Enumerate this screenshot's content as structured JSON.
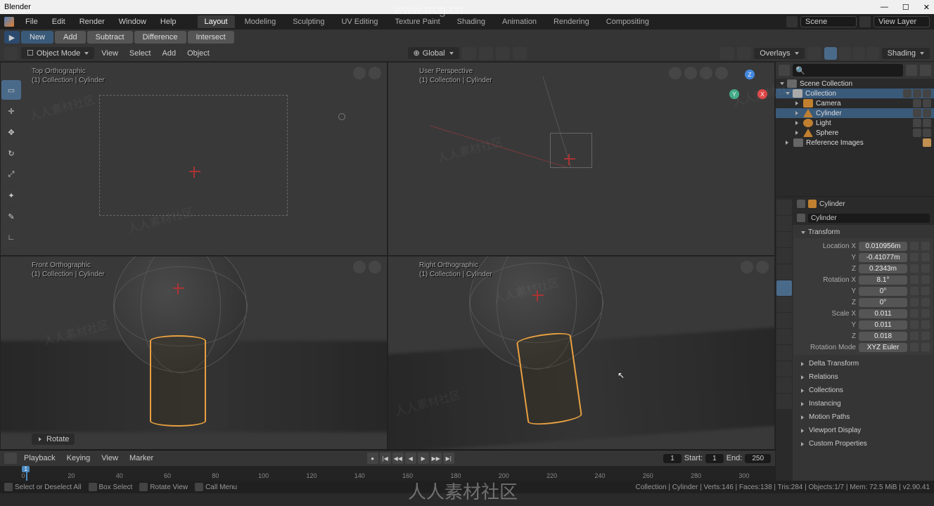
{
  "app": {
    "title": "Blender"
  },
  "menu": {
    "items": [
      "File",
      "Edit",
      "Render",
      "Window",
      "Help"
    ]
  },
  "tabs": {
    "items": [
      "Layout",
      "Modeling",
      "Sculpting",
      "UV Editing",
      "Texture Paint",
      "Shading",
      "Animation",
      "Rendering",
      "Compositing"
    ],
    "active": 0
  },
  "topright": {
    "scene_label": "Scene",
    "viewlayer_label": "View Layer"
  },
  "booltool": {
    "new": "New",
    "add": "Add",
    "subtract": "Subtract",
    "difference": "Difference",
    "intersect": "Intersect"
  },
  "vphead": {
    "mode": "Object Mode",
    "menus": [
      "View",
      "Select",
      "Add",
      "Object"
    ],
    "orientation": "Global",
    "overlays": "Overlays",
    "shading": "Shading"
  },
  "viewports": {
    "tl": {
      "name": "Top Orthographic",
      "sub": "(1) Collection | Cylinder"
    },
    "tr": {
      "name": "User Perspective",
      "sub": "(1) Collection | Cylinder"
    },
    "bl": {
      "name": "Front Orthographic",
      "sub": "(1) Collection | Cylinder"
    },
    "br": {
      "name": "Right Orthographic",
      "sub": "(1) Collection | Cylinder"
    },
    "op": "Rotate"
  },
  "outliner": {
    "root": "Scene Collection",
    "collection": "Collection",
    "items": [
      {
        "name": "Camera",
        "type": "cam"
      },
      {
        "name": "Cylinder",
        "type": "mesh",
        "active": true
      },
      {
        "name": "Light",
        "type": "light"
      },
      {
        "name": "Sphere",
        "type": "mesh"
      }
    ],
    "ref": "Reference Images"
  },
  "props": {
    "context": "Cylinder",
    "context2": "Cylinder",
    "panels": {
      "transform": {
        "title": "Transform",
        "rows": [
          {
            "label": "Location X",
            "value": "0.010956m"
          },
          {
            "label": "Y",
            "value": "-0.41077m"
          },
          {
            "label": "Z",
            "value": "0.2343m"
          },
          {
            "label": "Rotation X",
            "value": "8.1°"
          },
          {
            "label": "Y",
            "value": "0°"
          },
          {
            "label": "Z",
            "value": "0°"
          },
          {
            "label": "Scale X",
            "value": "0.011"
          },
          {
            "label": "Y",
            "value": "0.011"
          },
          {
            "label": "Z",
            "value": "0.018"
          },
          {
            "label": "Rotation Mode",
            "value": "XYZ Euler"
          }
        ]
      },
      "collapsed": [
        "Delta Transform",
        "Relations",
        "Collections",
        "Instancing",
        "Motion Paths",
        "Viewport Display",
        "Custom Properties"
      ]
    }
  },
  "timeline": {
    "menus": [
      "Playback",
      "Keying",
      "View",
      "Marker"
    ],
    "current": "1",
    "start_label": "Start:",
    "start": "1",
    "end_label": "End:",
    "end": "250",
    "ticks": [
      "0",
      "20",
      "40",
      "60",
      "80",
      "100",
      "120",
      "140",
      "160",
      "180",
      "200",
      "220",
      "240",
      "260",
      "280",
      "300"
    ]
  },
  "status": {
    "left": [
      {
        "text": "Select or Deselect All"
      },
      {
        "text": "Box Select"
      },
      {
        "text": "Rotate View"
      }
    ],
    "mid": "Call Menu",
    "right": "Collection | Cylinder | Verts:146 | Faces:138 | Tris:284 | Objects:1/7 | Mem: 72.5 MiB | v2.90.41"
  },
  "watermark": {
    "url": "www.rrcg.cn",
    "cn": "人人素材社区"
  }
}
